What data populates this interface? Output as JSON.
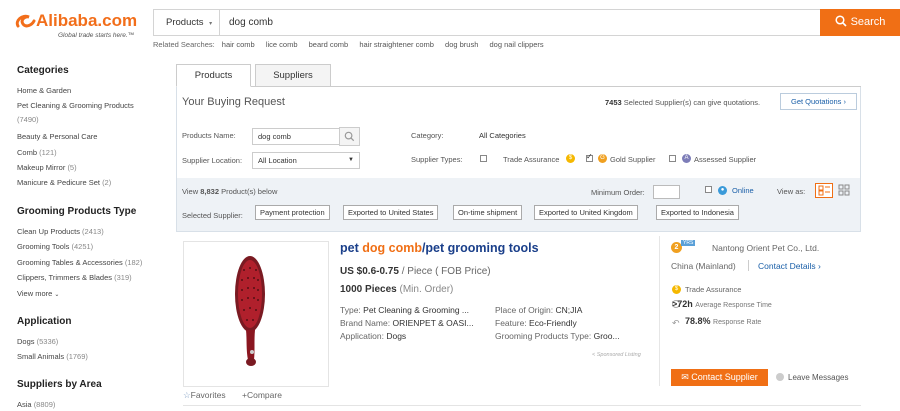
{
  "header": {
    "logo_mark": "ƹ",
    "logo_name": "Alibaba.com",
    "logo_tagline": "Global trade starts here.™",
    "search_category": "Products",
    "search_value": "dog comb",
    "search_button": "Search",
    "related_label": "Related Searches:",
    "related": [
      "hair comb",
      "lice comb",
      "beard comb",
      "hair straightener comb",
      "dog brush",
      "dog nail clippers"
    ]
  },
  "sidebar": {
    "categories_title": "Categories",
    "categories": [
      {
        "label": "Home & Garden",
        "count": ""
      },
      {
        "label": "Pet Cleaning & Grooming Products",
        "count": ""
      },
      {
        "label": "",
        "count": "(7490)"
      },
      {
        "label": "Beauty & Personal Care",
        "count": ""
      },
      {
        "label": "Comb",
        "count": "(121)"
      },
      {
        "label": "Makeup Mirror",
        "count": "(5)"
      },
      {
        "label": "Manicure & Pedicure Set",
        "count": "(2)"
      }
    ],
    "grooming_title": "Grooming Products Type",
    "grooming": [
      {
        "label": "Clean Up Products",
        "count": "(2413)"
      },
      {
        "label": "Grooming Tools",
        "count": "(4251)"
      },
      {
        "label": "Grooming Tables & Accessories",
        "count": "(182)"
      },
      {
        "label": "Clippers, Trimmers & Blades",
        "count": "(319)"
      }
    ],
    "view_more": "View more",
    "application_title": "Application",
    "application": [
      {
        "label": "Dogs",
        "count": "(5336)"
      },
      {
        "label": "Small Animals",
        "count": "(1769)"
      }
    ],
    "area_title": "Suppliers by Area",
    "area": [
      {
        "label": "Asia",
        "count": "(8809)"
      }
    ]
  },
  "tabs": {
    "products": "Products",
    "suppliers": "Suppliers"
  },
  "buying_request": {
    "title": "Your Buying Request",
    "count": "7453",
    "count_text": "Selected Supplier(s) can give quotations.",
    "quote_button": "Get Quotations ›",
    "products_name_label": "Products Name:",
    "products_name_value": "dog comb",
    "supplier_location_label": "Supplier Location:",
    "supplier_location_value": "All Location",
    "category_label": "Category:",
    "category_value": "All Categories",
    "supplier_types_label": "Supplier Types:",
    "trade_assurance": "Trade Assurance",
    "gold_supplier": "Gold Supplier",
    "assessed_supplier": "Assessed Supplier"
  },
  "filterbar": {
    "view_prefix": "View",
    "view_count": "8,832",
    "view_suffix": "Product(s) below",
    "min_order_label": "Minimum Order:",
    "online_label": "Online",
    "view_as_label": "View as:",
    "selected_supplier_label": "Selected Supplier:",
    "chips": [
      "Payment protection",
      "Exported to United States",
      "On-time shipment",
      "Exported to United Kingdom",
      "Exported to Indonesia"
    ]
  },
  "product": {
    "title_prefix": "pet ",
    "title_highlight": "dog comb",
    "title_suffix": "/pet grooming tools",
    "price": "US $0.6-0.75",
    "price_unit": "/ Piece ( FOB Price)",
    "moq": "1000 Pieces",
    "moq_unit": "(Min. Order)",
    "attrs_left": [
      {
        "k": "Type:",
        "v": "Pet Cleaning & Grooming ..."
      },
      {
        "k": "Brand Name:",
        "v": "ORIENPET & OASI..."
      },
      {
        "k": "Application:",
        "v": "Dogs"
      }
    ],
    "attrs_right": [
      {
        "k": "Place of Origin:",
        "v": "CN;JIA"
      },
      {
        "k": "Feature:",
        "v": "Eco-Friendly"
      },
      {
        "k": "Grooming Products Type:",
        "v": "Groo..."
      }
    ],
    "sponsored": "< Sponsored Listing",
    "favorites": "Favorites",
    "compare": "Compare"
  },
  "supplier": {
    "years": "2",
    "years_unit": "YRS",
    "name": "Nantong Orient Pet Co., Ltd.",
    "country": "China (Mainland)",
    "contact_details": "Contact Details ›",
    "trade_assurance": "Trade Assurance",
    "response_time": ">72h",
    "response_time_label": "Average Response Time",
    "response_rate": "78.8%",
    "response_rate_label": "Response Rate",
    "contact_button": "Contact Supplier",
    "leave_messages": "Leave Messages"
  },
  "colors": {
    "brand_orange": "#f06f15",
    "link_blue": "#1a5fa8"
  }
}
